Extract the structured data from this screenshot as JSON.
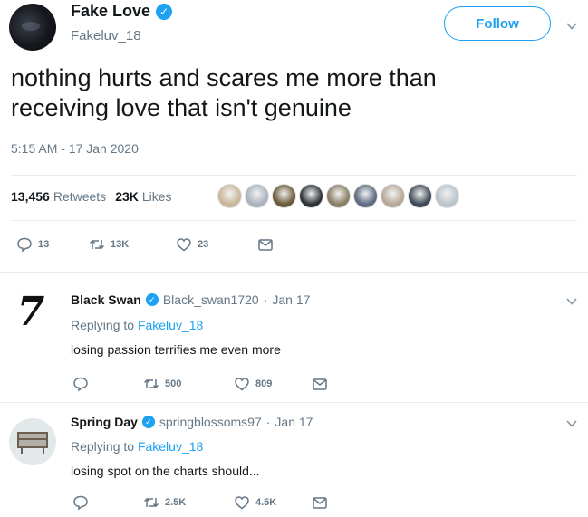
{
  "tweet": {
    "author": {
      "display_name": "Fake Love",
      "handle": "Fakeluv_18",
      "verified": true
    },
    "follow_label": "Follow",
    "text_lines": [
      "nothing hurts and scares me more than",
      "receiving love that isn't genuine"
    ],
    "timestamp": "5:15 AM - 17 Jan 2020",
    "stats": {
      "retweets_count": "13,456",
      "retweets_label": "Retweets",
      "likes_count": "23K",
      "likes_label": "Likes"
    },
    "actions": {
      "replies": "13",
      "retweets": "13K",
      "likes": "23"
    }
  },
  "replies": [
    {
      "display_name": "Black Swan",
      "handle": "Black_swan1720",
      "separator": "·",
      "date": "Jan 17",
      "avatar_text": "7",
      "replying_prefix": "Replying to",
      "replying_to": "Fakeluv_18",
      "text": "losing passion terrifies me even more",
      "actions": {
        "replies": "",
        "retweets": "500",
        "likes": "809"
      }
    },
    {
      "display_name": "Spring Day",
      "handle": "springblossoms97",
      "separator": "·",
      "date": "Jan 17",
      "replying_prefix": "Replying to",
      "replying_to": "Fakeluv_18",
      "text": "losing spot on the charts should...",
      "actions": {
        "replies": "",
        "retweets": "2.5K",
        "likes": "4.5K"
      }
    }
  ],
  "icons": {
    "verified": "verified-badge-icon",
    "reply": "reply-icon",
    "retweet": "retweet-icon",
    "like": "heart-icon",
    "dm": "envelope-icon",
    "more": "chevron-down-icon"
  },
  "colors": {
    "accent": "#1da1f2",
    "text": "#14171a",
    "muted": "#657786",
    "border": "#e6ecf0",
    "liker_avatars": [
      "#c9b79a",
      "#a9b3bd",
      "#6b5a3a",
      "#2f3338",
      "#8a7e66",
      "#5d6c80",
      "#b8a89a",
      "#3e4a57",
      "#b9c4cc"
    ]
  }
}
